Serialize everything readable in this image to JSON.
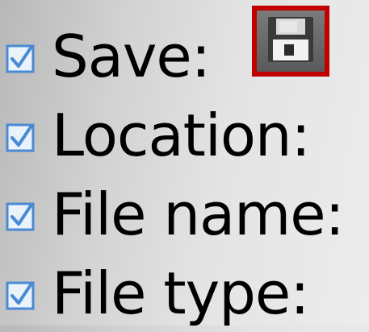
{
  "items": [
    {
      "label": "Save:",
      "checked": true
    },
    {
      "label": "Location:",
      "checked": true
    },
    {
      "label": "File name:",
      "checked": true
    },
    {
      "label": "File type:",
      "checked": true
    }
  ],
  "save_button": {
    "icon": "floppy-disk-icon",
    "border_color": "#c00000"
  },
  "colors": {
    "checkbox": "#4a8ad4",
    "text": "#000000"
  }
}
